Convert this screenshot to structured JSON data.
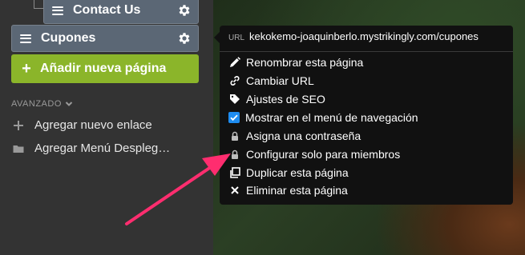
{
  "sidebar": {
    "pages": [
      {
        "label": "Contact Us"
      },
      {
        "label": "Cupones"
      }
    ],
    "add_page_label": "Añadir nueva página",
    "advanced": {
      "heading": "AVANZADO",
      "items": [
        {
          "label": "Agregar nuevo enlace",
          "icon": "plus-icon"
        },
        {
          "label": "Agregar Menú Despleg…",
          "icon": "folder-icon"
        }
      ]
    }
  },
  "popover": {
    "url_label": "URL",
    "url_value": "kekokemo-joaquinberlo.mystrikingly.com/cupones",
    "options": [
      {
        "label": "Renombrar esta página",
        "icon": "pencil-icon"
      },
      {
        "label": "Cambiar URL",
        "icon": "link-icon"
      },
      {
        "label": "Ajustes de SEO",
        "icon": "tag-icon"
      },
      {
        "label": "Mostrar en el menú de navegación",
        "icon": "checkbox-icon",
        "checked": true
      },
      {
        "label": "Asigna una contraseña",
        "icon": "lock-icon"
      },
      {
        "label": "Configurar solo para miembros",
        "icon": "lock-icon"
      },
      {
        "label": "Duplicar esta página",
        "icon": "copy-icon"
      },
      {
        "label": "Eliminar esta página",
        "icon": "close-icon"
      }
    ]
  },
  "colors": {
    "sidebar_bg": "#333333",
    "page_item_bg": "#5b6775",
    "add_button_bg": "#8bb52a",
    "popover_bg": "#111111",
    "checkbox_blue": "#1e8cf0",
    "annotation_arrow": "#ff2d6f"
  }
}
